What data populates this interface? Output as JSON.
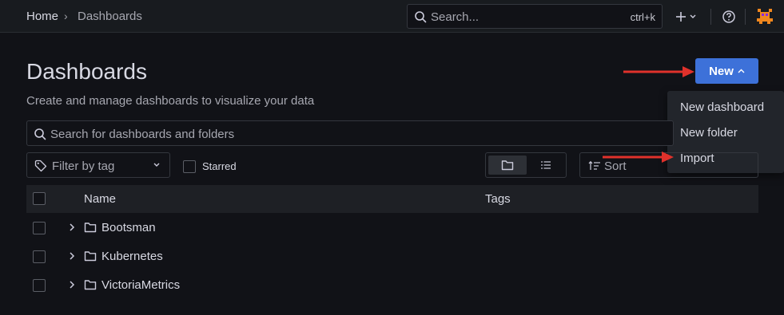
{
  "breadcrumb": {
    "home": "Home",
    "separator": "›",
    "current": "Dashboards"
  },
  "topbar": {
    "search_placeholder": "Search...",
    "search_shortcut": "ctrl+k",
    "plus_label": "+",
    "plus_chevron": "⌄"
  },
  "page": {
    "title": "Dashboards",
    "subtitle": "Create and manage dashboards to visualize your data"
  },
  "new_button": {
    "label": "New",
    "chevron": "⌃"
  },
  "new_menu": {
    "items": [
      {
        "label": "New dashboard"
      },
      {
        "label": "New folder"
      },
      {
        "label": "Import"
      }
    ]
  },
  "search": {
    "placeholder": "Search for dashboards and folders"
  },
  "filters": {
    "tag_placeholder": "Filter by tag",
    "starred_label": "Starred",
    "sort_placeholder": "Sort"
  },
  "table": {
    "columns": {
      "name": "Name",
      "tags": "Tags"
    },
    "rows": [
      {
        "name": "Bootsman"
      },
      {
        "name": "Kubernetes"
      },
      {
        "name": "VictoriaMetrics"
      }
    ]
  },
  "colors": {
    "background": "#111217",
    "primary_button": "#3d71d9",
    "annotation_arrow": "#e0312b"
  }
}
